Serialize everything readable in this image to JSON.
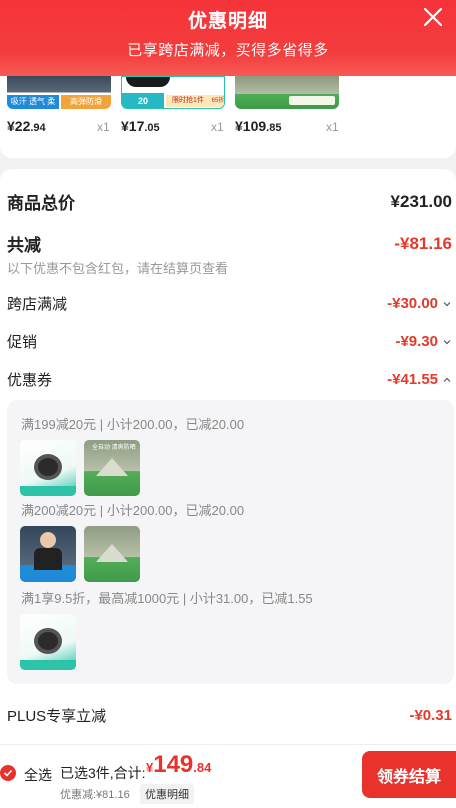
{
  "header": {
    "title": "优惠明细",
    "subtitle": "已享跨店满减，买得多省得多"
  },
  "products": [
    {
      "price_int": "¥22",
      "price_dec": ".94",
      "qty": "x1",
      "tags": [
        "吸汗 透气 柔软",
        "高弹防滑"
      ]
    },
    {
      "price_int": "¥17",
      "price_dec": ".05",
      "qty": "x1",
      "tags": [
        "20",
        "限时抢1件",
        "65折"
      ]
    },
    {
      "price_int": "¥109",
      "price_dec": ".85",
      "qty": "x1",
      "tags": []
    }
  ],
  "summary": {
    "goods_total_label": "商品总价",
    "goods_total_value": "¥231.00",
    "total_reduction_label": "共减",
    "total_reduction_value": "-¥81.16",
    "note": "以下优惠不包含红包，请在结算页查看",
    "cross_store_label": "跨店满减",
    "cross_store_value": "-¥30.00",
    "promo_label": "促销",
    "promo_value": "-¥9.30",
    "coupon_label": "优惠券",
    "coupon_value": "-¥41.55",
    "plus_label": "PLUS专享立减",
    "plus_value": "-¥0.31"
  },
  "coupons": [
    {
      "text": "满199减20元 | 小计200.00，已减20.00",
      "thumb_tag": "全自动 清爽防晒"
    },
    {
      "text": "满200减20元 | 小计200.00，已减20.00"
    },
    {
      "text": "满1享9.5折，最高减1000元 | 小计31.00，已减1.55"
    }
  ],
  "footer": {
    "select_all": "全选",
    "selected_count": "已选3件,合计:",
    "total_currency": "¥",
    "total_int": "149",
    "total_dec": ".84",
    "discount_text": "优惠减:¥81.16",
    "discount_detail_button": "优惠明细",
    "checkout_button": "领券结算"
  },
  "colors": {
    "brand_red": "#e8322b",
    "header_red": "#f5333a",
    "muted_gray": "#999999"
  }
}
